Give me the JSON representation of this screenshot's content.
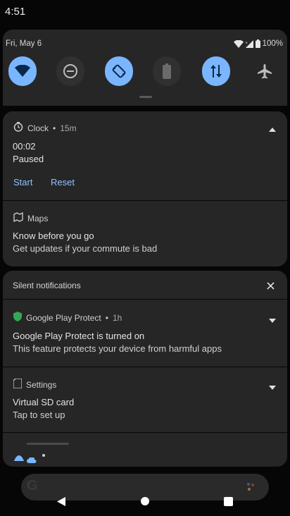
{
  "status_bar": {
    "time": "4:51"
  },
  "quick_settings": {
    "date": "Fri, May 6",
    "battery": "100%",
    "accent_color": "#7ab6ff",
    "tiles": [
      {
        "name": "wifi",
        "icon": "wifi-icon",
        "on": true
      },
      {
        "name": "do-not-disturb",
        "icon": "do-not-disturb-icon",
        "on": false
      },
      {
        "name": "auto-rotate",
        "icon": "auto-rotate-icon",
        "on": true
      },
      {
        "name": "battery-saver",
        "icon": "battery-saver-icon",
        "on": false
      },
      {
        "name": "mobile-data",
        "icon": "mobile-data-icon",
        "on": true
      },
      {
        "name": "airplane-mode",
        "icon": "airplane-icon",
        "on": false
      }
    ]
  },
  "notifications": {
    "clock": {
      "app": "Clock",
      "when": "15m",
      "time": "00:02",
      "state": "Paused",
      "actions": {
        "start": "Start",
        "reset": "Reset"
      }
    },
    "maps": {
      "app": "Maps",
      "title": "Know before you go",
      "text": "Get updates if your commute is bad"
    },
    "silent": {
      "label": "Silent notifications"
    },
    "play_protect": {
      "app": "Google Play Protect",
      "when": "1h",
      "title": "Google Play Protect is turned on",
      "text": "This feature protects your device from harmful apps"
    },
    "settings": {
      "app": "Settings",
      "title": "Virtual SD card",
      "text": "Tap to set up"
    }
  }
}
